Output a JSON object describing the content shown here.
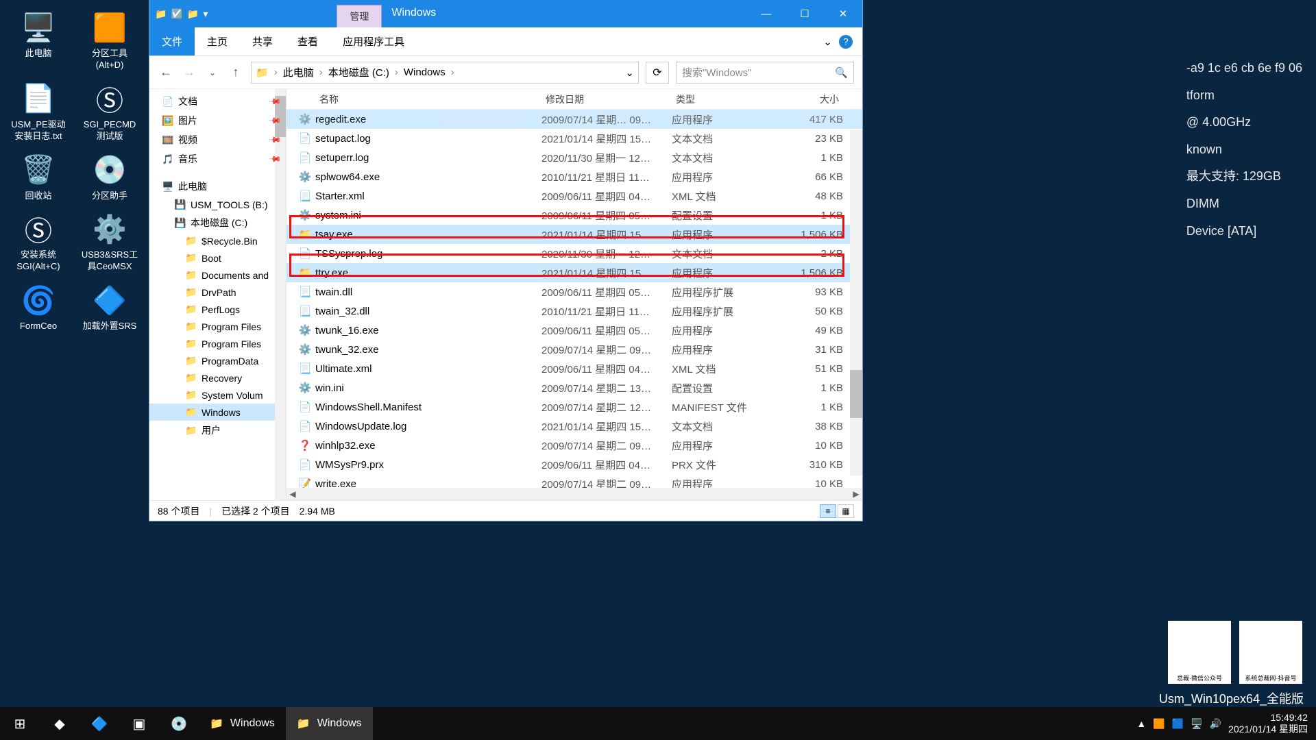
{
  "desktop": {
    "icons": [
      {
        "label": "此电脑",
        "glyph": "🖥️"
      },
      {
        "label": "USM_PE驱动安装日志.txt",
        "glyph": "📄"
      },
      {
        "label": "回收站",
        "glyph": "🗑️"
      },
      {
        "label": "安装系统SGI(Alt+C)",
        "glyph": "Ⓢ"
      },
      {
        "label": "FormCeo",
        "glyph": "🌀"
      },
      {
        "label": "分区工具(Alt+D)",
        "glyph": "🟧"
      },
      {
        "label": "SGI_PECMD测试版",
        "glyph": "Ⓢ"
      },
      {
        "label": "分区助手",
        "glyph": "💿"
      },
      {
        "label": "USB3&SRS工具CeoMSX",
        "glyph": "⚙️"
      },
      {
        "label": "加载外置SRS",
        "glyph": "🔷"
      }
    ]
  },
  "sysinfo": {
    "l1": "-a9 1c e6 cb 6e f9 06",
    "l2": "tform",
    "l3": "@ 4.00GHz",
    "l4": "known",
    "l5": "最大支持: 129GB",
    "l6": "DIMM",
    "l7": "Device  [ATA]"
  },
  "qr": {
    "a": "总裁·微信公众号",
    "b": "系统总裁网·抖音号"
  },
  "watermark": "Usm_Win10pex64_全能版",
  "explorer": {
    "manage_tab": "管理",
    "title": "Windows",
    "ribbon": {
      "file": "文件",
      "home": "主页",
      "share": "共享",
      "view": "查看",
      "apptools": "应用程序工具"
    },
    "breadcrumbs": [
      "此电脑",
      "本地磁盘 (C:)",
      "Windows"
    ],
    "search_placeholder": "搜索\"Windows\"",
    "columns": {
      "name": "名称",
      "date": "修改日期",
      "type": "类型",
      "size": "大小"
    },
    "nav": {
      "quick": [
        {
          "label": "文档",
          "ico": "📄"
        },
        {
          "label": "图片",
          "ico": "🖼️"
        },
        {
          "label": "视频",
          "ico": "🎞️"
        },
        {
          "label": "音乐",
          "ico": "🎵"
        }
      ],
      "thispc": "此电脑",
      "usm": "USM_TOOLS (B:)",
      "cdrive": "本地磁盘 (C:)",
      "cdrive_children": [
        "$Recycle.Bin",
        "Boot",
        "Documents and",
        "DrvPath",
        "PerfLogs",
        "Program Files",
        "Program Files",
        "ProgramData",
        "Recovery",
        "System Volum",
        "Windows",
        "用户"
      ]
    },
    "files": [
      {
        "ico": "⚙️",
        "name": "regedit.exe",
        "date": "2009/07/14 星期… 09…",
        "type": "应用程序",
        "size": "417 KB",
        "sel": true,
        "cut": true
      },
      {
        "ico": "📄",
        "name": "setupact.log",
        "date": "2021/01/14 星期四 15…",
        "type": "文本文档",
        "size": "23 KB"
      },
      {
        "ico": "📄",
        "name": "setuperr.log",
        "date": "2020/11/30 星期一 12…",
        "type": "文本文档",
        "size": "1 KB"
      },
      {
        "ico": "⚙️",
        "name": "splwow64.exe",
        "date": "2010/11/21 星期日 11…",
        "type": "应用程序",
        "size": "66 KB"
      },
      {
        "ico": "📃",
        "name": "Starter.xml",
        "date": "2009/06/11 星期四 04…",
        "type": "XML 文档",
        "size": "48 KB"
      },
      {
        "ico": "⚙️",
        "name": "system.ini",
        "date": "2009/06/11 星期四 05…",
        "type": "配置设置",
        "size": "1 KB"
      },
      {
        "ico": "📁",
        "name": "tsay.exe",
        "date": "2021/01/14 星期四 15…",
        "type": "应用程序",
        "size": "1,506 KB",
        "sel": true
      },
      {
        "ico": "📄",
        "name": "TSSysprep.log",
        "date": "2020/11/30 星期一 12…",
        "type": "文本文档",
        "size": "2 KB"
      },
      {
        "ico": "📁",
        "name": "ttry.exe",
        "date": "2021/01/14 星期四 15…",
        "type": "应用程序",
        "size": "1,506 KB",
        "sel": true
      },
      {
        "ico": "📃",
        "name": "twain.dll",
        "date": "2009/06/11 星期四 05…",
        "type": "应用程序扩展",
        "size": "93 KB"
      },
      {
        "ico": "📃",
        "name": "twain_32.dll",
        "date": "2010/11/21 星期日 11…",
        "type": "应用程序扩展",
        "size": "50 KB"
      },
      {
        "ico": "⚙️",
        "name": "twunk_16.exe",
        "date": "2009/06/11 星期四 05…",
        "type": "应用程序",
        "size": "49 KB"
      },
      {
        "ico": "⚙️",
        "name": "twunk_32.exe",
        "date": "2009/07/14 星期二 09…",
        "type": "应用程序",
        "size": "31 KB"
      },
      {
        "ico": "📃",
        "name": "Ultimate.xml",
        "date": "2009/06/11 星期四 04…",
        "type": "XML 文档",
        "size": "51 KB"
      },
      {
        "ico": "⚙️",
        "name": "win.ini",
        "date": "2009/07/14 星期二 13…",
        "type": "配置设置",
        "size": "1 KB"
      },
      {
        "ico": "📄",
        "name": "WindowsShell.Manifest",
        "date": "2009/07/14 星期二 12…",
        "type": "MANIFEST 文件",
        "size": "1 KB"
      },
      {
        "ico": "📄",
        "name": "WindowsUpdate.log",
        "date": "2021/01/14 星期四 15…",
        "type": "文本文档",
        "size": "38 KB"
      },
      {
        "ico": "❓",
        "name": "winhlp32.exe",
        "date": "2009/07/14 星期二 09…",
        "type": "应用程序",
        "size": "10 KB"
      },
      {
        "ico": "📄",
        "name": "WMSysPr9.prx",
        "date": "2009/06/11 星期四 04…",
        "type": "PRX 文件",
        "size": "310 KB"
      },
      {
        "ico": "📝",
        "name": "write.exe",
        "date": "2009/07/14 星期二 09…",
        "type": "应用程序",
        "size": "10 KB"
      }
    ],
    "status": {
      "items": "88 个项目",
      "selected": "已选择 2 个项目",
      "size": "2.94 MB"
    }
  },
  "taskbar": {
    "tasks": [
      {
        "label": "Windows",
        "active": false
      },
      {
        "label": "Windows",
        "active": true
      }
    ],
    "clock": {
      "time": "15:49:42",
      "date": "2021/01/14 星期四"
    }
  }
}
